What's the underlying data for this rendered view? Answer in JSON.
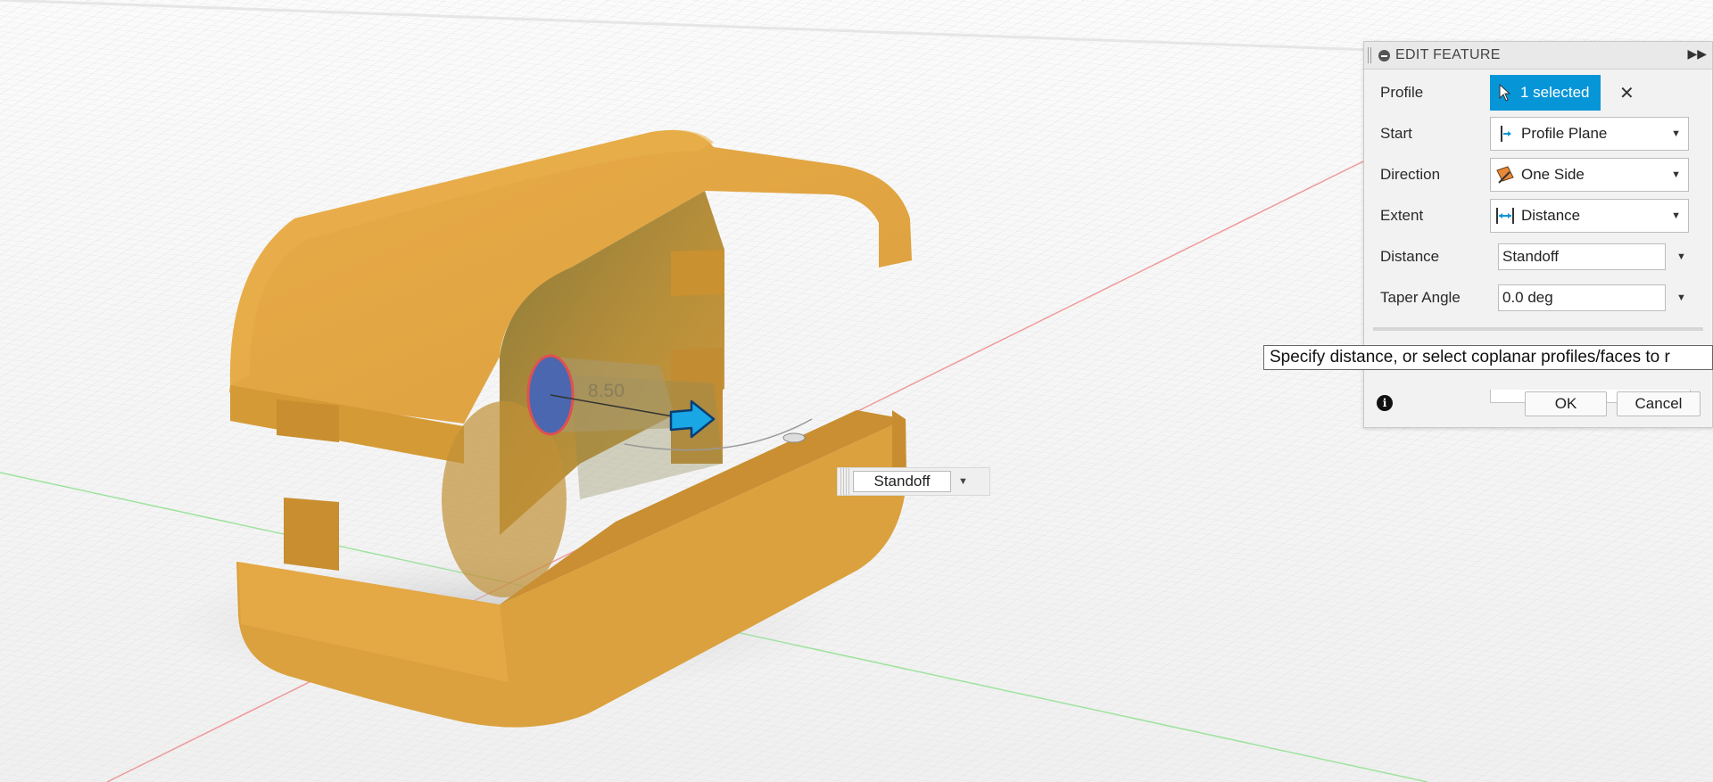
{
  "canvas": {
    "dimension_label": "8.50",
    "input_value": "Standoff",
    "colors": {
      "body": "#e2a43f",
      "selected_face": "#4a67b0",
      "arrow": "#19a7e6",
      "grid": "#d9d9d9"
    }
  },
  "panel": {
    "title": "EDIT FEATURE",
    "rows": {
      "profile": {
        "label": "Profile",
        "value": "1 selected"
      },
      "start": {
        "label": "Start",
        "value": "Profile Plane"
      },
      "direction": {
        "label": "Direction",
        "value": "One Side"
      },
      "extent": {
        "label": "Extent",
        "value": "Distance"
      },
      "distance": {
        "label": "Distance",
        "value": "Standoff"
      },
      "taper": {
        "label": "Taper Angle",
        "value": "0.0 deg"
      }
    },
    "ok_label": "OK",
    "cancel_label": "Cancel",
    "accent": "#0696d7"
  },
  "tooltip": {
    "text": "Specify distance, or select coplanar profiles/faces to r"
  }
}
